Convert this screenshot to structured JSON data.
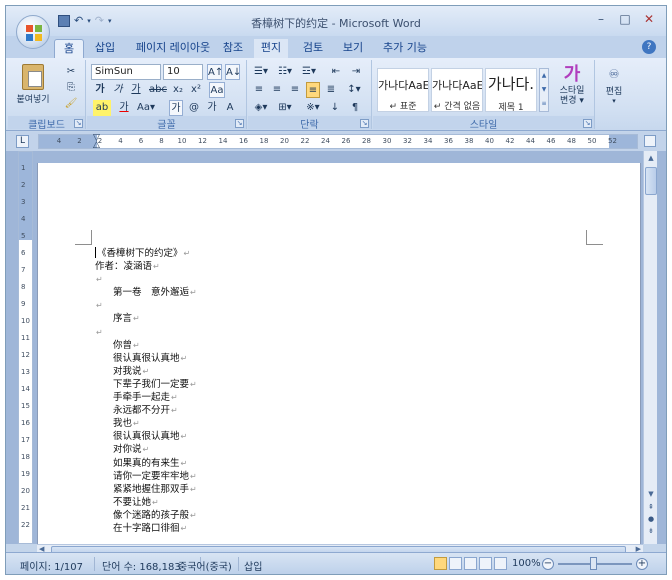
{
  "window": {
    "title": "香樟树下的约定 - Microsoft Word"
  },
  "tabs": [
    "홈",
    "삽입",
    "페이지 레이아웃",
    "참조",
    "편지",
    "검토",
    "보기",
    "추가 기능"
  ],
  "ribbon": {
    "clipboard": {
      "label": "클립보드",
      "paste": "붙여넣기"
    },
    "font": {
      "label": "글꼴",
      "name": "SimSun",
      "size": "10"
    },
    "paragraph": {
      "label": "단락"
    },
    "styles": {
      "label": "스타일",
      "items": [
        {
          "preview": "가나다AaE",
          "name": "↵ 표준"
        },
        {
          "preview": "가나다AaE",
          "name": "↵ 간격 없음"
        },
        {
          "preview": "가나다.",
          "name": "제목 1"
        }
      ],
      "change_label": "스타일",
      "change_label2": "변경 ▾"
    },
    "editing": {
      "label": "편집"
    }
  },
  "ruler": {
    "ticks": [
      "4",
      "2",
      "2",
      "4",
      "6",
      "8",
      "10",
      "12",
      "14",
      "16",
      "18",
      "20",
      "22",
      "24",
      "26",
      "28",
      "30",
      "32",
      "34",
      "36",
      "38",
      "40",
      "42",
      "44",
      "46",
      "48",
      "50",
      "52"
    ],
    "vticks": [
      "1",
      "2",
      "3",
      "4",
      "5",
      "6",
      "7",
      "8",
      "9",
      "10",
      "11",
      "12",
      "13",
      "14",
      "15",
      "16",
      "17",
      "18",
      "19",
      "20",
      "21",
      "22"
    ]
  },
  "document": {
    "lines": [
      {
        "text": "《香樟树下的约定》",
        "indent": false
      },
      {
        "text": "作者：凌涵语",
        "indent": false
      },
      {
        "text": "",
        "indent": false
      },
      {
        "text": "第一卷　意外邂逅",
        "indent": true
      },
      {
        "text": "",
        "indent": false
      },
      {
        "text": "序言",
        "indent": true
      },
      {
        "text": "",
        "indent": false
      },
      {
        "text": "你曾",
        "indent": true
      },
      {
        "text": "很认真很认真地",
        "indent": true
      },
      {
        "text": "对我说",
        "indent": true
      },
      {
        "text": "下辈子我们一定要",
        "indent": true
      },
      {
        "text": "手牵手一起走",
        "indent": true
      },
      {
        "text": "永远都不分开",
        "indent": true
      },
      {
        "text": "我也",
        "indent": true
      },
      {
        "text": "很认真很认真地",
        "indent": true
      },
      {
        "text": "对你说",
        "indent": true
      },
      {
        "text": "如果真的有来生",
        "indent": true
      },
      {
        "text": "请你一定要牢牢地",
        "indent": true
      },
      {
        "text": "紧紧地握住那双手",
        "indent": true
      },
      {
        "text": "不要让她",
        "indent": true
      },
      {
        "text": "像个迷路的孩子般",
        "indent": true
      },
      {
        "text": "在十字路口徘徊",
        "indent": true
      }
    ]
  },
  "statusbar": {
    "page": "페이지: 1/107",
    "words": "단어 수: 168,183",
    "language": "중국어(중국)",
    "mode": "삽입",
    "zoom": "100%"
  }
}
